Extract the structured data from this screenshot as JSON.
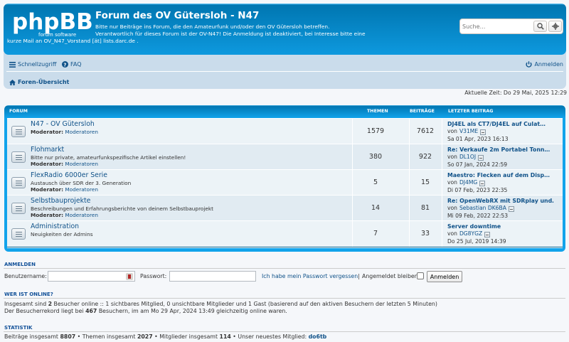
{
  "site": {
    "logo_text": "phpBB",
    "logo_sub": "forum software",
    "title": "Forum des OV Gütersloh - N47",
    "desc_line1": "Bitte nur Beiträge ins Forum, die den Amateurfunk und/oder den OV Gütersloh betreffen.",
    "desc_line2": "Verantwortlich für dieses Forum ist der OV-N47! Die Anmeldung ist deaktiviert, bei Interesse bitte eine",
    "desc_line3": "kurze Mail an OV_N47_Vorstand [ät] lists.darc.de ."
  },
  "search": {
    "placeholder": "Suche…"
  },
  "nav": {
    "quick": "Schnellzugriff",
    "faq": "FAQ",
    "login": "Anmelden",
    "breadcrumb": "Foren-Übersicht"
  },
  "current_time": "Aktuelle Zeit: Do 29 Mai, 2025 12:29",
  "table_header": {
    "forum": "Forum",
    "topics": "Themen",
    "posts": "Beiträge",
    "last_post": "Letzter Beitrag"
  },
  "forums": [
    {
      "title": "N47 - OV Gütersloh",
      "desc": "",
      "mod_label": "Moderator:",
      "mod": "Moderatoren",
      "topics": "1579",
      "posts": "7612",
      "last_title": "DJ4EL als CT7/DJ4EL auf Culat…",
      "last_by": "von",
      "last_user": "V31ME",
      "last_date": "Sa 01 Apr, 2023 16:13"
    },
    {
      "title": "Flohmarkt",
      "desc": "Bitte nur private, amateurfunkspezifische Artikel einstellen!",
      "mod_label": "Moderator:",
      "mod": "Moderatoren",
      "topics": "380",
      "posts": "922",
      "last_title": "Re: Verkaufe 2m Portabel Tonn…",
      "last_by": "von",
      "last_user": "DL1OJ",
      "last_date": "So 07 Jan, 2024 22:59"
    },
    {
      "title": "FlexRadio 6000er Serie",
      "desc": "Austausch über SDR der 3. Generation",
      "mod_label": "Moderator:",
      "mod": "Moderatoren",
      "topics": "5",
      "posts": "15",
      "last_title": "Maestro: Flecken auf dem Disp…",
      "last_by": "von",
      "last_user": "DJ4MG",
      "last_date": "Di 07 Feb, 2023 22:35"
    },
    {
      "title": "Selbstbauprojekte",
      "desc": "Beschreibungen und Erfahrungsberichte von deinem Selbstbauprojekt",
      "mod_label": "Moderator:",
      "mod": "Moderatoren",
      "topics": "14",
      "posts": "81",
      "last_title": "Re: OpenWebRX mit SDRplay und…",
      "last_by": "von",
      "last_user": "Sebastian DK6BA",
      "last_date": "Mi 09 Feb, 2022 22:53"
    },
    {
      "title": "Administration",
      "desc": "Neuigkeiten der Admins",
      "mod_label": "",
      "mod": "",
      "topics": "7",
      "posts": "33",
      "last_title": "Server downtime",
      "last_by": "von",
      "last_user": "DG8YGZ",
      "last_date": "Do 25 Jul, 2019 14:39"
    }
  ],
  "login_section": {
    "title": "Anmelden",
    "username_label": "Benutzername:",
    "password_label": "Passwort:",
    "forgot": "Ich habe mein Passwort vergessen",
    "separator": "|",
    "remember": "Angemeldet bleiben",
    "button": "Anmelden"
  },
  "online": {
    "title": "Wer ist online?",
    "line1_a": "Insgesamt sind ",
    "line1_b": "2",
    "line1_c": " Besucher online :: 1 sichtbares Mitglied, 0 unsichtbare Mitglieder und 1 Gast (basierend auf den aktiven Besuchern der letzten 5 Minuten)",
    "line2_a": "Der Besucherrekord liegt bei ",
    "line2_b": "467",
    "line2_c": " Besuchern, im am Mo 29 Apr, 2024 13:49 gleichzeitig online waren."
  },
  "stats": {
    "title": "Statistik",
    "posts_label": "Beiträge insgesamt ",
    "posts": "8807",
    "topics_label": " • Themen insgesamt ",
    "topics": "2027",
    "members_label": " • Mitglieder insgesamt ",
    "members": "114",
    "newest_label": " • Unser neuestes Mitglied: ",
    "newest": "do6tb"
  }
}
